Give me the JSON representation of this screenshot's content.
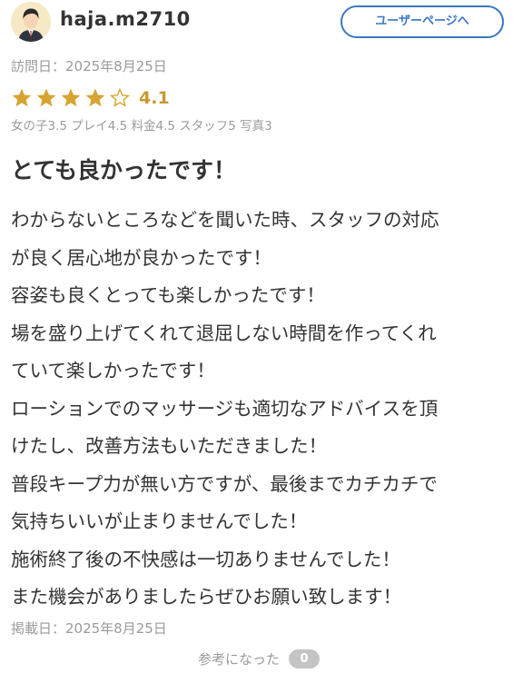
{
  "user": {
    "name": "haja.m2710",
    "page_button": "ユーザーページへ"
  },
  "visit_date": "訪問日：2025年8月25日",
  "rating": {
    "stars_filled": 4,
    "stars_total": 5,
    "value": "4.1",
    "star_color": "#d7a431"
  },
  "subratings": "女の子3.5 プレイ4.5 料金4.5 スタッフ5 写真3",
  "review": {
    "title": "とても良かったです！",
    "lines": [
      "わからないところなどを聞いた時、スタッフの対応",
      "が良く居心地が良かったです！",
      "容姿も良くとっても楽しかったです！",
      "場を盛り上げてくれて退屈しない時間を作ってくれ",
      "ていて楽しかったです！",
      "ローションでのマッサージも適切なアドバイスを頂",
      "けたし、改善方法もいただきました！",
      "普段キープ力が無い方ですが、最後までカチカチで",
      "気持ちいいが止まりませんでした！",
      "施術終了後の不快感は一切ありませんでした！",
      "また機会がありましたらぜひお願い致します！"
    ]
  },
  "post_date": "掲載日：2025年8月25日",
  "helpful": {
    "label": "参考になった",
    "count": "0"
  },
  "colors": {
    "accent": "#3a78c2",
    "muted": "#9a9a9a",
    "text": "#333333"
  }
}
